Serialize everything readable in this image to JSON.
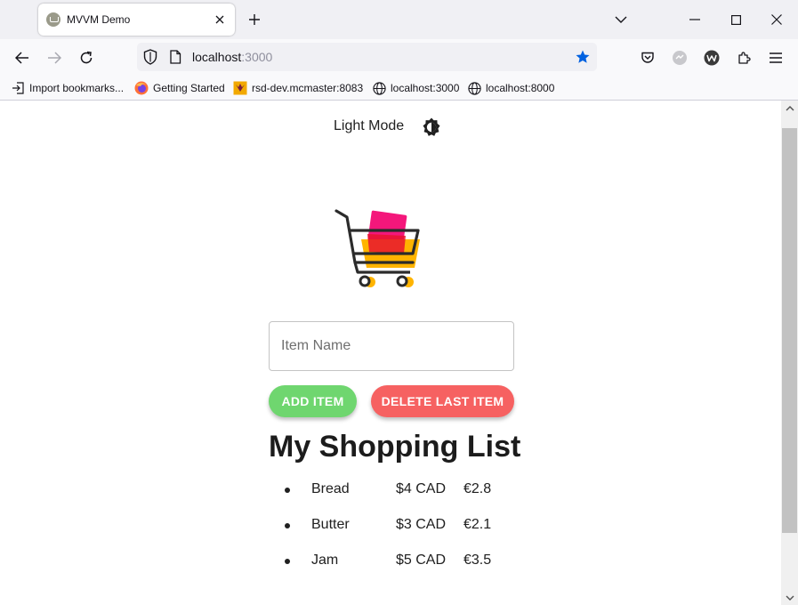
{
  "browser": {
    "tab": {
      "title": "MVVM Demo",
      "favicon": "cart-favicon-icon"
    },
    "url": {
      "host": "localhost",
      "port": ":3000"
    },
    "bookmarks": [
      {
        "label": "Import bookmarks...",
        "icon": "import-icon"
      },
      {
        "label": "Getting Started",
        "icon": "firefox-icon"
      },
      {
        "label": "rsd-dev.mcmaster:8083",
        "icon": "site-icon"
      },
      {
        "label": "localhost:3000",
        "icon": "globe-icon"
      },
      {
        "label": "localhost:8000",
        "icon": "globe-icon"
      }
    ]
  },
  "page": {
    "mode_label": "Light Mode",
    "mode_icon": "brightness-icon",
    "logo": "shopping-cart-logo",
    "input": {
      "placeholder": "Item Name",
      "value": ""
    },
    "add_button": "ADD ITEM",
    "delete_button": "DELETE LAST ITEM",
    "list_title": "My Shopping List",
    "items": [
      {
        "name": "Bread",
        "cad": "$4 CAD",
        "eur": "€2.8"
      },
      {
        "name": "Butter",
        "cad": "$3 CAD",
        "eur": "€2.1"
      },
      {
        "name": "Jam",
        "cad": "$5 CAD",
        "eur": "€3.5"
      }
    ]
  },
  "colors": {
    "add_button": "#6fd66f",
    "delete_button": "#f66161",
    "bookmark_star": "#0061e0"
  }
}
